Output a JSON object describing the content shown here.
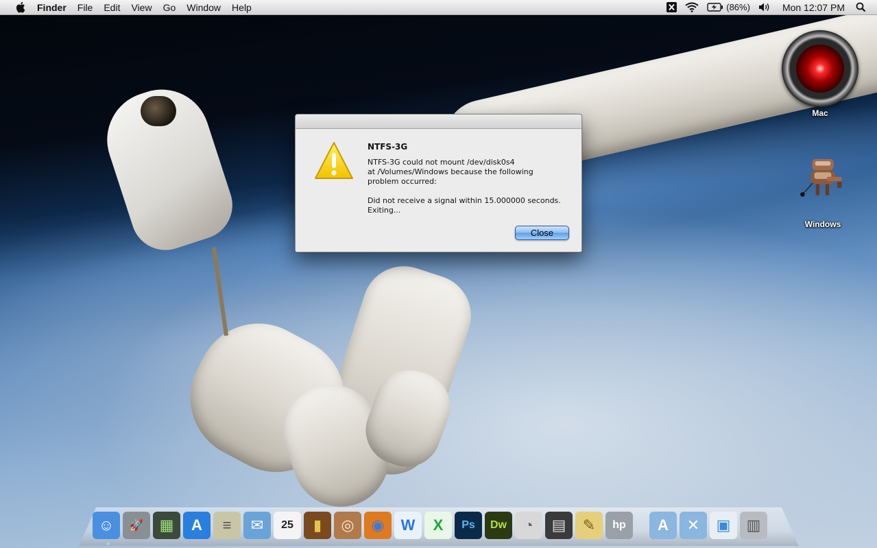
{
  "menubar": {
    "app_name": "Finder",
    "menus": [
      "File",
      "Edit",
      "View",
      "Go",
      "Window",
      "Help"
    ],
    "battery": "(86%)",
    "clock": "Mon 12:07 PM"
  },
  "desktop": {
    "icons": [
      {
        "label": "Mac",
        "icon": "hal-9000-icon"
      },
      {
        "label": "Windows",
        "icon": "robot-drive-icon"
      }
    ]
  },
  "dialog": {
    "title": "NTFS-3G",
    "message": "NTFS-3G could not mount /dev/disk0s4\nat /Volumes/Windows because the following\nproblem occurred:\n\nDid not receive a signal within 15.000000 seconds.\nExiting...",
    "close_label": "Close"
  },
  "dock": {
    "items": [
      {
        "name": "finder-icon",
        "glyph": "☺",
        "bg": "#4a8fe0",
        "fg": "#ffffff"
      },
      {
        "name": "launchpad-icon",
        "glyph": "🚀",
        "bg": "#8a8f96",
        "fg": "#ffffff"
      },
      {
        "name": "mission-control-icon",
        "glyph": "▦",
        "bg": "#3c4a3c",
        "fg": "#9be07a"
      },
      {
        "name": "app-store-icon",
        "glyph": "A",
        "bg": "#2a7ee0",
        "fg": "#ffffff"
      },
      {
        "name": "system-info-icon",
        "glyph": "≡",
        "bg": "#c9c6a8",
        "fg": "#555555"
      },
      {
        "name": "mail-icon",
        "glyph": "✉",
        "bg": "#6aa3d8",
        "fg": "#ffffff"
      },
      {
        "name": "calendar-icon",
        "glyph": "25",
        "bg": "#f4f4f4",
        "fg": "#222222"
      },
      {
        "name": "notebook-icon",
        "glyph": "▮",
        "bg": "#7a4a1e",
        "fg": "#e6c34a"
      },
      {
        "name": "tape-icon",
        "glyph": "◎",
        "bg": "#b07a4a",
        "fg": "#f0e6d8"
      },
      {
        "name": "firefox-icon",
        "glyph": "◉",
        "bg": "#e07a1e",
        "fg": "#3a7ad8"
      },
      {
        "name": "word-icon",
        "glyph": "W",
        "bg": "#e9f2fb",
        "fg": "#2a76d8"
      },
      {
        "name": "excel-icon",
        "glyph": "X",
        "bg": "#e8f7e8",
        "fg": "#1fa83a"
      },
      {
        "name": "photoshop-icon",
        "glyph": "Ps",
        "bg": "#0b2a4a",
        "fg": "#5cb4f5"
      },
      {
        "name": "dreamweaver-icon",
        "glyph": "Dw",
        "bg": "#2b3a12",
        "fg": "#b5e03a"
      },
      {
        "name": "disk-utility-icon",
        "glyph": "◔",
        "bg": "#d8d8d8",
        "fg": "#666666"
      },
      {
        "name": "calculator-icon",
        "glyph": "▤",
        "bg": "#3a3a3a",
        "fg": "#dddddd"
      },
      {
        "name": "stickies-icon",
        "glyph": "✎",
        "bg": "#e6cf7a",
        "fg": "#7a5a1e"
      },
      {
        "name": "hp-printer-icon",
        "glyph": "hp",
        "bg": "#9aa0a8",
        "fg": "#ffffff"
      },
      {
        "name": "applications-folder-icon",
        "glyph": "A",
        "bg": "#8ab6e0",
        "fg": "#ffffff"
      },
      {
        "name": "utilities-folder-icon",
        "glyph": "✕",
        "bg": "#8ab6e0",
        "fg": "#ffffff"
      },
      {
        "name": "preview-icon",
        "glyph": "▣",
        "bg": "#e8eef4",
        "fg": "#3a8ad8"
      },
      {
        "name": "trash-icon",
        "glyph": "▥",
        "bg": "#b8bcc2",
        "fg": "#555555"
      }
    ]
  }
}
